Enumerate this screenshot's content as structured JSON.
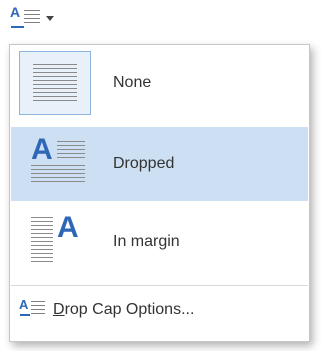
{
  "toolbar": {
    "button_icon": "drop-cap-icon",
    "dropdown_icon": "chevron-down-icon"
  },
  "menu": {
    "items": [
      {
        "label": "None",
        "icon": "drop-cap-none-icon",
        "selected": false
      },
      {
        "label": "Dropped",
        "icon": "drop-cap-dropped-icon",
        "selected": true
      },
      {
        "label": "In margin",
        "icon": "drop-cap-in-margin-icon",
        "selected": false
      }
    ],
    "options": {
      "accelerator": "D",
      "rest": "rop Cap Options...",
      "icon": "drop-cap-options-icon"
    }
  },
  "colors": {
    "accent": "#2e67b8",
    "selected_bg": "#cde0f3",
    "border": "#c6c6c6"
  }
}
